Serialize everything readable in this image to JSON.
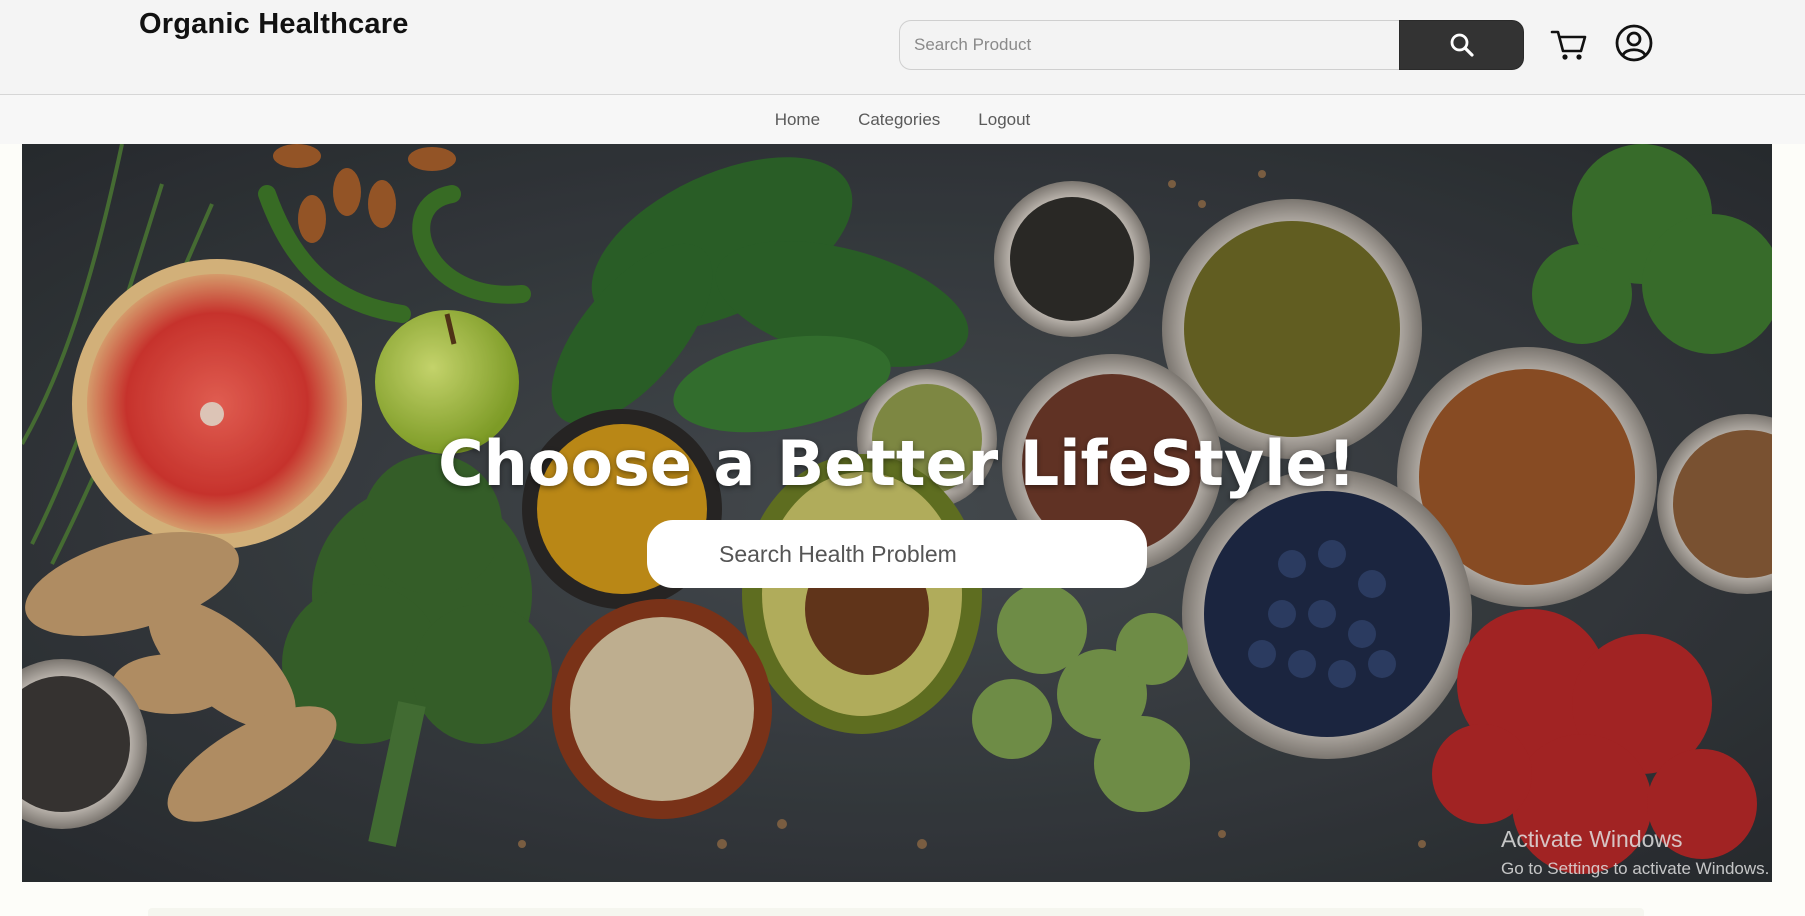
{
  "brand": {
    "name": "Organic Healthcare"
  },
  "header": {
    "search_placeholder": "Search Product",
    "search_icon": "search-icon",
    "cart_icon": "cart-icon",
    "account_icon": "user-account-icon"
  },
  "nav": {
    "items": [
      {
        "label": "Home"
      },
      {
        "label": "Categories"
      },
      {
        "label": "Logout"
      }
    ]
  },
  "hero": {
    "headline": "Choose a Better LifeStyle!",
    "search_placeholder": "Search Health Problem"
  },
  "os_overlay": {
    "title": "Activate Windows",
    "subtitle": "Go to Settings to activate Windows."
  },
  "colors": {
    "header_bg": "#f4f4f4",
    "search_button": "#333333",
    "hero_text": "#ffffff",
    "nav_text": "#5a5a5a"
  }
}
